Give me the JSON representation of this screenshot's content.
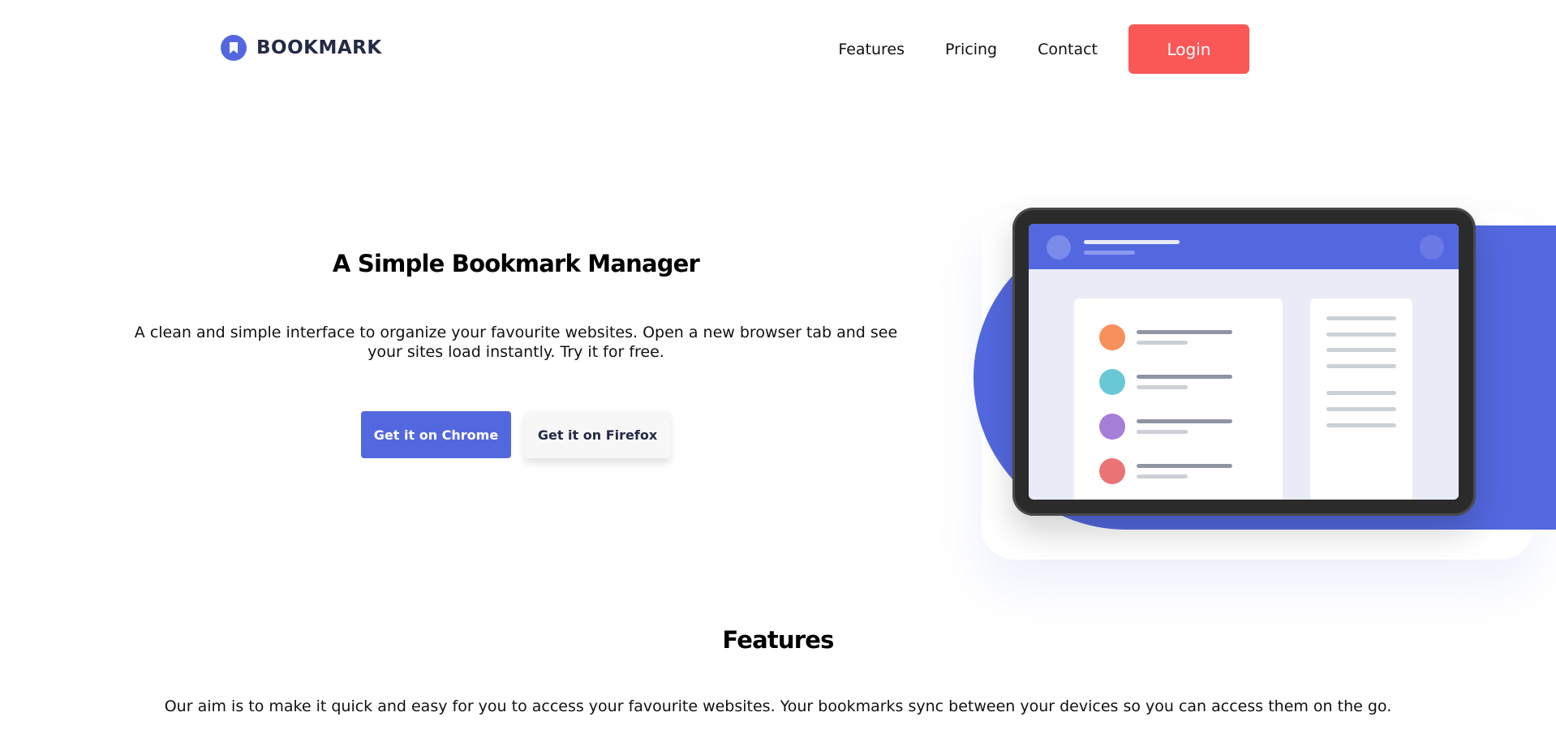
{
  "brand": {
    "name": "BOOKMARK",
    "icon": "bookmark-icon",
    "color": "#5368df"
  },
  "nav": {
    "items": [
      {
        "label": "Features"
      },
      {
        "label": "Pricing"
      },
      {
        "label": "Contact"
      }
    ],
    "login_label": "Login",
    "login_color": "#fa5757"
  },
  "hero": {
    "title": "A Simple Bookmark Manager",
    "description": "A clean and simple interface to organize your favourite websites. Open a new browser tab and see your sites load instantly. Try it for free.",
    "chrome_button": "Get it on Chrome",
    "firefox_button": "Get it on Firefox"
  },
  "illustration": {
    "accent": "#5368df",
    "bookmark_dot_colors": [
      "#f7905a",
      "#69c8d6",
      "#a57ed7",
      "#ea7475"
    ]
  },
  "features": {
    "title": "Features",
    "description": "Our aim is to make it quick and easy for you to access your favourite websites. Your bookmarks sync between your devices so you can access them on the go."
  }
}
